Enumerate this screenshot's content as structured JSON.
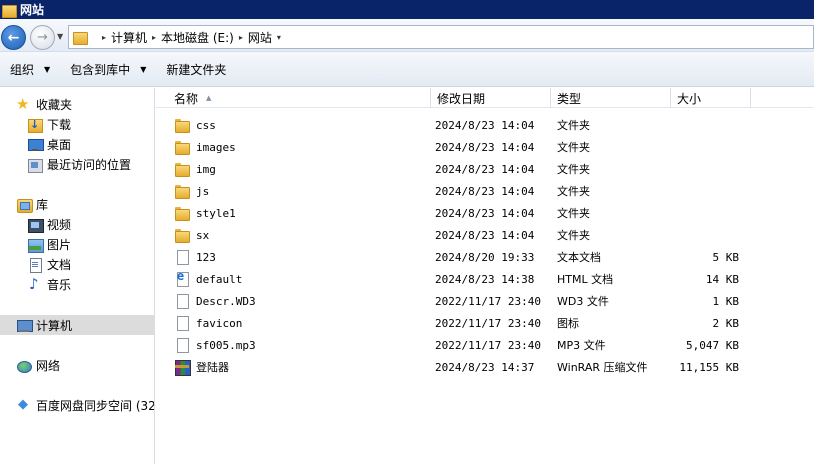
{
  "window": {
    "title": "网站"
  },
  "address": {
    "crumbs": [
      "计算机",
      "本地磁盘 (E:)",
      "网站"
    ]
  },
  "toolbar": {
    "organize": "组织",
    "include_library": "包含到库中",
    "new_folder": "新建文件夹"
  },
  "nav": {
    "favorites": "收藏夹",
    "downloads": "下载",
    "desktop": "桌面",
    "recent": "最近访问的位置",
    "libraries": "库",
    "videos": "视频",
    "pictures": "图片",
    "documents": "文档",
    "music": "音乐",
    "computer": "计算机",
    "network": "网络",
    "baidu": "百度网盘同步空间 (32"
  },
  "columns": {
    "name": "名称",
    "date": "修改日期",
    "type": "类型",
    "size": "大小"
  },
  "files": [
    {
      "name": "css",
      "date": "2024/8/23 14:04",
      "type": "文件夹",
      "size": "",
      "icon": "folder-icon"
    },
    {
      "name": "images",
      "date": "2024/8/23 14:04",
      "type": "文件夹",
      "size": "",
      "icon": "folder-icon"
    },
    {
      "name": "img",
      "date": "2024/8/23 14:04",
      "type": "文件夹",
      "size": "",
      "icon": "folder-icon"
    },
    {
      "name": "js",
      "date": "2024/8/23 14:04",
      "type": "文件夹",
      "size": "",
      "icon": "folder-icon"
    },
    {
      "name": "style1",
      "date": "2024/8/23 14:04",
      "type": "文件夹",
      "size": "",
      "icon": "folder-icon"
    },
    {
      "name": "sx",
      "date": "2024/8/23 14:04",
      "type": "文件夹",
      "size": "",
      "icon": "folder-icon"
    },
    {
      "name": "123",
      "date": "2024/8/20 19:33",
      "type": "文本文档",
      "size": "5 KB",
      "icon": "text-file-icon"
    },
    {
      "name": "default",
      "date": "2024/8/23 14:38",
      "type": "HTML 文档",
      "size": "14 KB",
      "icon": "html-file-icon"
    },
    {
      "name": "Descr.WD3",
      "date": "2022/11/17 23:40",
      "type": "WD3 文件",
      "size": "1 KB",
      "icon": "file-icon"
    },
    {
      "name": "favicon",
      "date": "2022/11/17 23:40",
      "type": "图标",
      "size": "2 KB",
      "icon": "file-icon"
    },
    {
      "name": "sf005.mp3",
      "date": "2022/11/17 23:40",
      "type": "MP3 文件",
      "size": "5,047 KB",
      "icon": "file-icon"
    },
    {
      "name": "登陆器",
      "date": "2024/8/23 14:37",
      "type": "WinRAR 压缩文件",
      "size": "11,155 KB",
      "icon": "winrar-archive-icon"
    }
  ]
}
